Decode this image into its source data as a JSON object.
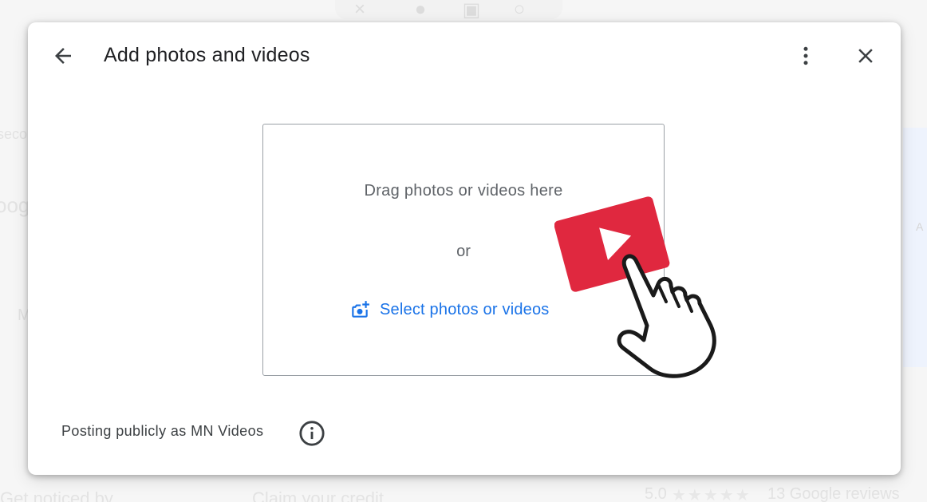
{
  "dialog": {
    "title": "Add photos and videos",
    "back_icon": "arrow-left-icon",
    "more_icon": "more-vert-icon",
    "close_icon": "close-icon"
  },
  "dropzone": {
    "drag_text": "Drag photos or videos here",
    "or_text": "or",
    "select_label": "Select photos or videos",
    "select_icon": "add-photo-icon"
  },
  "overlay": {
    "play_icon": "play-icon",
    "hand_icon": "pointing-hand-icon"
  },
  "footer": {
    "posting_text": "Posting publicly as MN Videos",
    "info_icon": "info-icon"
  },
  "background": {
    "bottom_left": "Get noticed by",
    "bottom_middle": "Claim your credit",
    "rating": "5.0",
    "reviews": "13 Google reviews",
    "left_fragment_1": "seco",
    "left_fragment_2": "oog",
    "left_fragment_3": "M",
    "right_fragment": "A"
  },
  "colors": {
    "accent_blue": "#1a73e8",
    "play_red": "#e0283f",
    "text_dark": "#202124",
    "text_gray": "#5f6368"
  }
}
